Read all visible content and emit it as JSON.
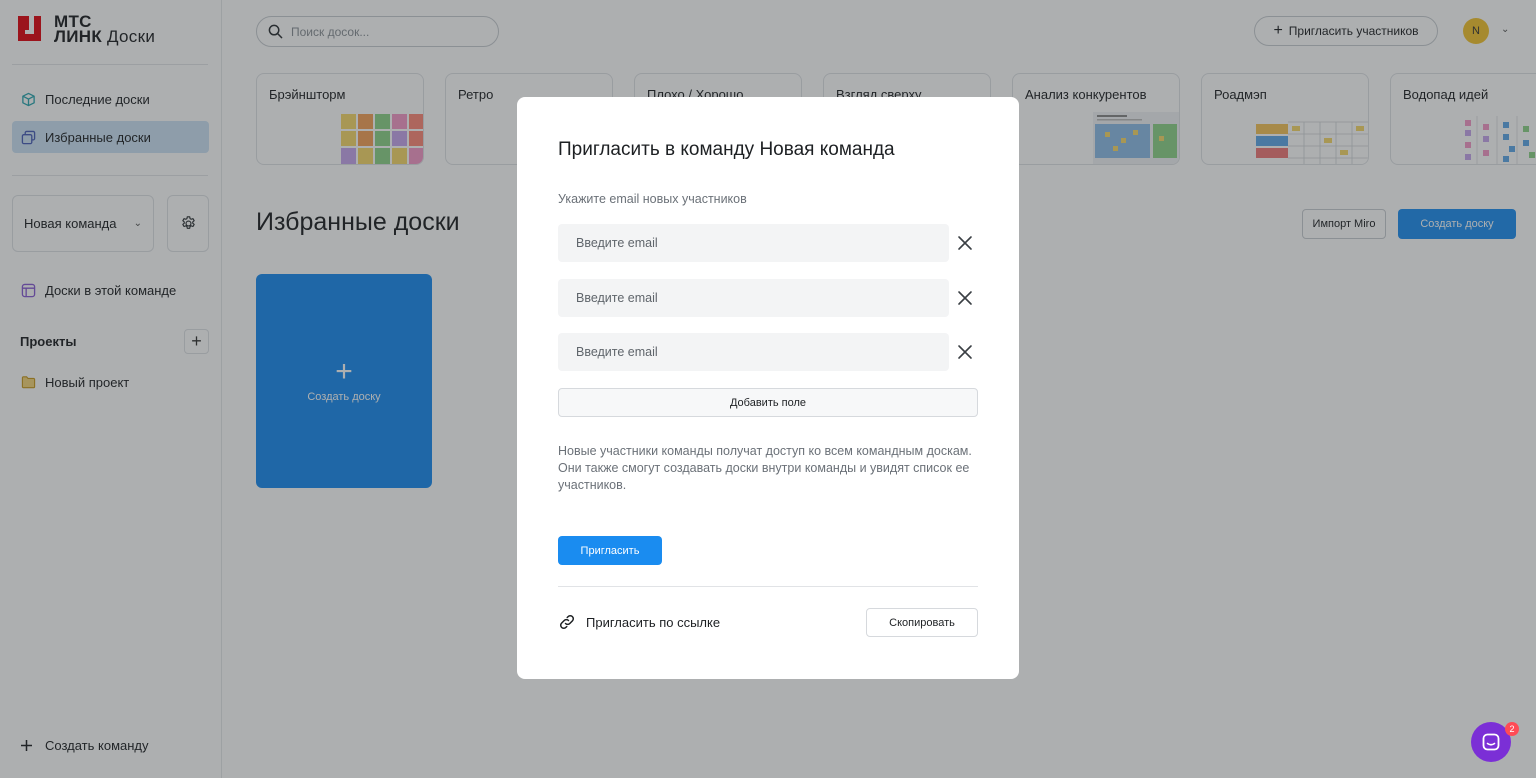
{
  "logo": {
    "line1": "МТС",
    "line2": "ЛИНК",
    "line2_suffix": "Доски",
    "brand_color": "#e30611"
  },
  "sidebar": {
    "items": [
      {
        "label": "Последние доски",
        "icon": "cube-icon"
      },
      {
        "label": "Избранные доски",
        "icon": "boards-stack-icon",
        "active": true
      }
    ],
    "team": {
      "name": "Новая команда"
    },
    "team_boards": {
      "label": "Доски в этой команде"
    },
    "projects": {
      "title": "Проекты",
      "items": [
        {
          "label": "Новый проект"
        }
      ]
    },
    "create_team": "Создать команду"
  },
  "header": {
    "search_placeholder": "Поиск досок...",
    "invite_label": "Пригласить участников",
    "avatar_initial": "N"
  },
  "templates": [
    {
      "title": "Брэйншторм"
    },
    {
      "title": "Ретро"
    },
    {
      "title": "Плохо / Хорошо"
    },
    {
      "title": "Взгляд сверху"
    },
    {
      "title": "Анализ конкурентов"
    },
    {
      "title": "Роадмэп"
    },
    {
      "title": "Водопад идей"
    }
  ],
  "main": {
    "title": "Избранные доски",
    "import_label": "Импорт Miro",
    "create_label": "Создать доску",
    "create_card_label": "Создать доску",
    "accent_color": "#1a8cf0"
  },
  "modal": {
    "title": "Пригласить в команду Новая команда",
    "subtitle": "Укажите email новых участников",
    "email_placeholder": "Введите email",
    "emails": [
      "",
      "",
      ""
    ],
    "add_field_label": "Добавить поле",
    "info_line1": "Новые участники команды получат доступ ко всем командным доскам.",
    "info_line2": "Они также смогут создавать доски внутри команды и увидят список ее участников.",
    "invite_label": "Пригласить",
    "link_label": "Пригласить по ссылке",
    "copy_label": "Скопировать"
  },
  "chat": {
    "badge": "2"
  }
}
